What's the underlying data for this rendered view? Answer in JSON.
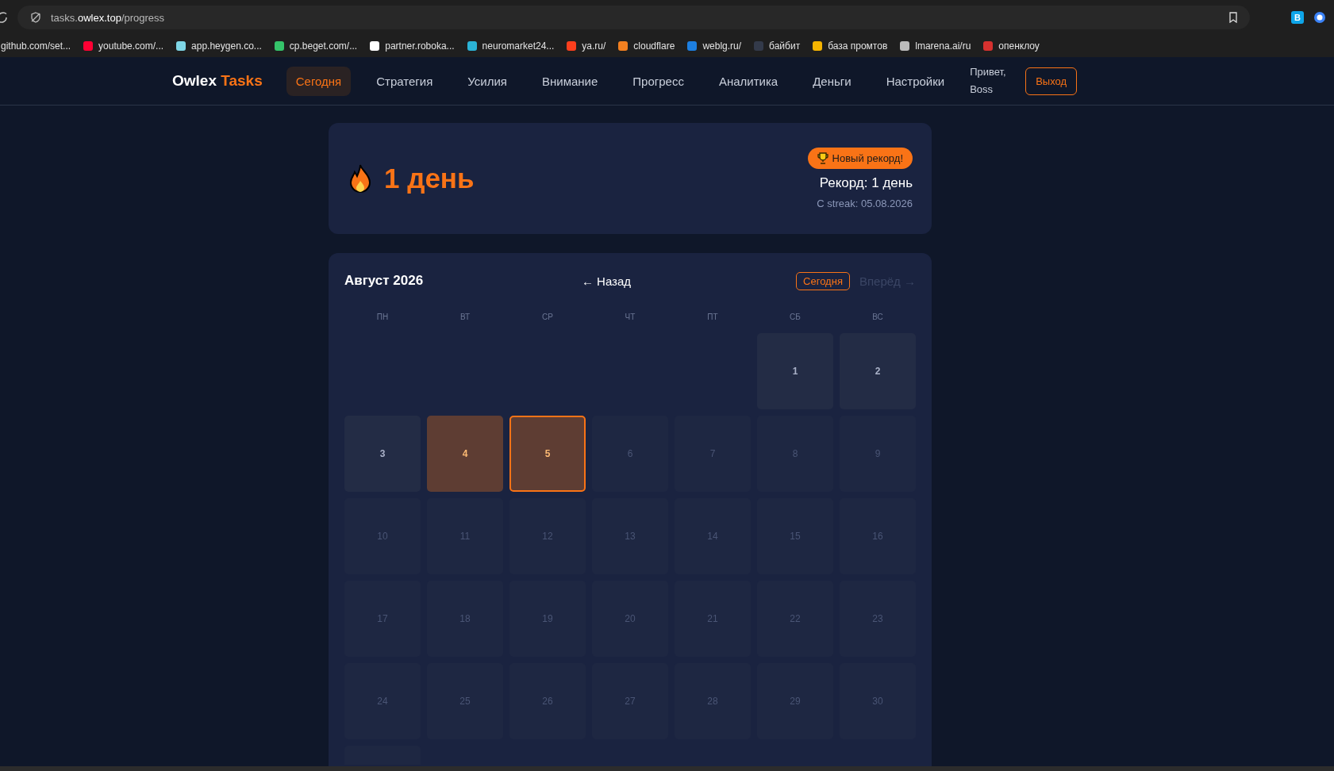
{
  "browser": {
    "address": "tasks.**owlex.top**/progress",
    "extension_label": "B",
    "bookmarks": [
      "github.com/set...",
      "youtube.com/...",
      "app.heygen.co...",
      "cp.beget.com/...",
      "partner.roboka...",
      "neuromarket24...",
      "ya.ru/",
      "cloudflare",
      "weblg.ru/",
      "байбит",
      "база промтов",
      "lmarena.ai/ru",
      "опенклоу"
    ]
  },
  "nav": {
    "logo": "Owlex",
    "logo_accent": "Tasks",
    "items": [
      {
        "label": "Сегодня",
        "selected": true
      },
      {
        "label": "Стратегия",
        "selected": false
      },
      {
        "label": "Усилия",
        "selected": false
      },
      {
        "label": "Внимание",
        "selected": false
      },
      {
        "label": "Прогресс",
        "selected": false
      },
      {
        "label": "Аналитика",
        "selected": false
      },
      {
        "label": "Деньги",
        "selected": false
      },
      {
        "label": "Настройки",
        "selected": false
      }
    ],
    "greeting": "Привет, Boss",
    "logout": "Выход"
  },
  "streak": {
    "value": "1 день",
    "badge": "Новый рекорд!",
    "record": "Рекорд: 1 день",
    "since": "С streak: 05.08.2026"
  },
  "calendar": {
    "title": "Август 2026",
    "back": "← Назад",
    "today": "Сегодня",
    "forward": "Вперёд →",
    "forward_disabled": true,
    "weekdays": [
      "ПН",
      "ВТ",
      "СР",
      "ЧТ",
      "ПТ",
      "СБ",
      "ВС"
    ],
    "weeks": [
      [
        {
          "kind": "blank"
        },
        {
          "kind": "blank"
        },
        {
          "kind": "blank"
        },
        {
          "kind": "blank"
        },
        {
          "kind": "blank"
        },
        {
          "kind": "day",
          "day": "1",
          "past": true,
          "done": false,
          "today": false
        },
        {
          "kind": "day",
          "day": "2",
          "past": true,
          "done": false,
          "today": false
        }
      ],
      [
        {
          "kind": "day",
          "day": "3",
          "past": true,
          "done": false,
          "today": false
        },
        {
          "kind": "day",
          "day": "4",
          "done": true,
          "today": false
        },
        {
          "kind": "day",
          "day": "5",
          "done": true,
          "today": true
        },
        {
          "kind": "day",
          "day": "6",
          "past": false,
          "done": false,
          "today": false
        },
        {
          "kind": "day",
          "day": "7",
          "past": false,
          "done": false,
          "today": false
        },
        {
          "kind": "day",
          "day": "8",
          "past": false,
          "done": false,
          "today": false
        },
        {
          "kind": "day",
          "day": "9",
          "past": false,
          "done": false,
          "today": false
        }
      ],
      [
        {
          "kind": "day",
          "day": "10",
          "past": false,
          "done": false,
          "today": false
        },
        {
          "kind": "day",
          "day": "11",
          "past": false,
          "done": false,
          "today": false
        },
        {
          "kind": "day",
          "day": "12",
          "past": false,
          "done": false,
          "today": false
        },
        {
          "kind": "day",
          "day": "13",
          "past": false,
          "done": false,
          "today": false
        },
        {
          "kind": "day",
          "day": "14",
          "past": false,
          "done": false,
          "today": false
        },
        {
          "kind": "day",
          "day": "15",
          "past": false,
          "done": false,
          "today": false
        },
        {
          "kind": "day",
          "day": "16",
          "past": false,
          "done": false,
          "today": false
        }
      ],
      [
        {
          "kind": "day",
          "day": "17",
          "past": false,
          "done": false,
          "today": false
        },
        {
          "kind": "day",
          "day": "18",
          "past": false,
          "done": false,
          "today": false
        },
        {
          "kind": "day",
          "day": "19",
          "past": false,
          "done": false,
          "today": false
        },
        {
          "kind": "day",
          "day": "20",
          "past": false,
          "done": false,
          "today": false
        },
        {
          "kind": "day",
          "day": "21",
          "past": false,
          "done": false,
          "today": false
        },
        {
          "kind": "day",
          "day": "22",
          "past": false,
          "done": false,
          "today": false
        },
        {
          "kind": "day",
          "day": "23",
          "past": false,
          "done": false,
          "today": false
        }
      ],
      [
        {
          "kind": "day",
          "day": "24",
          "past": false,
          "done": false,
          "today": false
        },
        {
          "kind": "day",
          "day": "25",
          "past": false,
          "done": false,
          "today": false
        },
        {
          "kind": "day",
          "day": "26",
          "past": false,
          "done": false,
          "today": false
        },
        {
          "kind": "day",
          "day": "27",
          "past": false,
          "done": false,
          "today": false
        },
        {
          "kind": "day",
          "day": "28",
          "past": false,
          "done": false,
          "today": false
        },
        {
          "kind": "day",
          "day": "29",
          "past": false,
          "done": false,
          "today": false
        },
        {
          "kind": "day",
          "day": "30",
          "past": false,
          "done": false,
          "today": false
        }
      ],
      [
        {
          "kind": "day",
          "done": false,
          "today": false
        }
      ]
    ]
  }
}
